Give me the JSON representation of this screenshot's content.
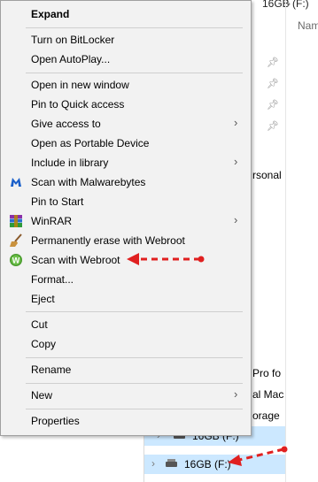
{
  "background": {
    "breadcrumb_drive": "16GB (F:)",
    "column_name": "Nam",
    "partial_texts": [
      "rsonal",
      "Pro fo",
      "al Mac",
      "orage"
    ],
    "drive_rows": [
      {
        "label": "16GB (F:)"
      },
      {
        "label": "16GB (F:)"
      }
    ]
  },
  "menu": {
    "items": [
      {
        "label": "Expand",
        "bold": true
      },
      {
        "label": "Turn on BitLocker"
      },
      {
        "label": "Open AutoPlay..."
      },
      {
        "label": "Open in new window"
      },
      {
        "label": "Pin to Quick access"
      },
      {
        "label": "Give access to",
        "submenu": true
      },
      {
        "label": "Open as Portable Device"
      },
      {
        "label": "Include in library",
        "submenu": true
      },
      {
        "label": "Scan with Malwarebytes",
        "icon": "malwarebytes-icon"
      },
      {
        "label": "Pin to Start"
      },
      {
        "label": "WinRAR",
        "icon": "winrar-icon",
        "submenu": true
      },
      {
        "label": "Permanently erase with Webroot",
        "icon": "webroot-erase-icon"
      },
      {
        "label": "Scan with Webroot",
        "icon": "webroot-icon"
      },
      {
        "label": "Format..."
      },
      {
        "label": "Eject"
      },
      {
        "label": "Cut"
      },
      {
        "label": "Copy"
      },
      {
        "label": "Rename"
      },
      {
        "label": "New",
        "submenu": true
      },
      {
        "label": "Properties"
      }
    ]
  },
  "colors": {
    "menu_bg": "#f2f2f2",
    "selection": "#cce8ff",
    "annotation_arrow": "#e02020"
  }
}
